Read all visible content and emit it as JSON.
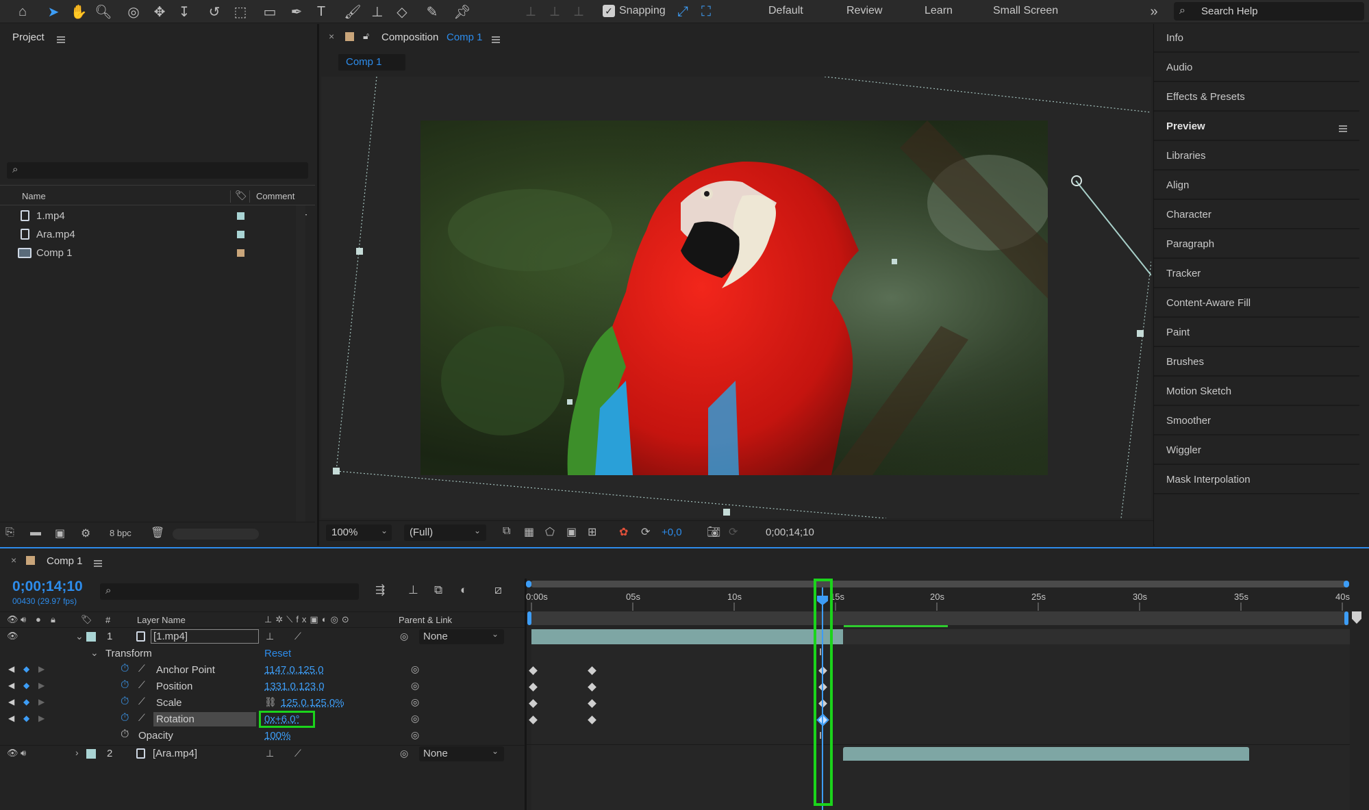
{
  "toolbar": {
    "snapping_label": "Snapping",
    "workspaces": [
      "Default",
      "Review",
      "Learn",
      "Small Screen"
    ],
    "search_placeholder": "Search Help"
  },
  "project": {
    "title": "Project",
    "columns": {
      "name": "Name",
      "comment": "Comment"
    },
    "items": [
      {
        "name": "1.mp4",
        "label_color": "#a9d4d4"
      },
      {
        "name": "Ara.mp4",
        "label_color": "#a9d4d4"
      },
      {
        "name": "Comp 1",
        "label_color": "#c9a57a"
      }
    ],
    "bpc": "8 bpc"
  },
  "composition": {
    "tab_prefix": "Composition",
    "tab_name": "Comp 1",
    "subtab": "Comp 1",
    "zoom": "100%",
    "resolution": "(Full)",
    "exposure": "+0,0",
    "timecode": "0;00;14;10"
  },
  "right_panel": {
    "items": [
      "Info",
      "Audio",
      "Effects & Presets",
      "Preview",
      "Libraries",
      "Align",
      "Character",
      "Paragraph",
      "Tracker",
      "Content-Aware Fill",
      "Paint",
      "Brushes",
      "Motion Sketch",
      "Smoother",
      "Wiggler",
      "Mask Interpolation"
    ],
    "active": "Preview"
  },
  "timeline": {
    "tab": "Comp 1",
    "timecode": "0;00;14;10",
    "frame_info": "00430 (29.97 fps)",
    "headers": {
      "num": "#",
      "layer_name": "Layer Name",
      "parent": "Parent & Link"
    },
    "ruler": [
      "0:00s",
      "05s",
      "10s",
      "15s",
      "20s",
      "25s",
      "30s",
      "35s",
      "40s"
    ],
    "layers": [
      {
        "num": "1",
        "name": "[1.mp4]",
        "parent": "None"
      },
      {
        "num": "2",
        "name": "[Ara.mp4]",
        "parent": "None"
      }
    ],
    "transform": {
      "label": "Transform",
      "reset": "Reset"
    },
    "properties": [
      {
        "name": "Anchor Point",
        "value": "1147,0,125,0"
      },
      {
        "name": "Position",
        "value": "1331,0,123,0"
      },
      {
        "name": "Scale",
        "value": "125,0,125,0%"
      },
      {
        "name": "Rotation",
        "value": "0x+6,0°"
      },
      {
        "name": "Opacity",
        "value": "100%"
      }
    ]
  }
}
